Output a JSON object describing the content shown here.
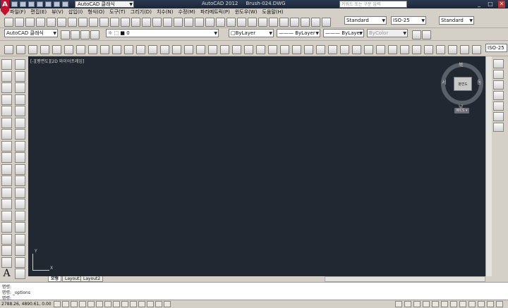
{
  "window": {
    "title": "AutoCAD 2012",
    "drawing": "Brush-024.DWG",
    "workspace": "AutoCAD 클래식",
    "search_placeholder": "키워드 또는 구문 입력",
    "min": "_",
    "max": "□",
    "close": "✕"
  },
  "menu": [
    "파일(F)",
    "편집(E)",
    "뷰(V)",
    "삽입(I)",
    "형식(O)",
    "도구(T)",
    "그리기(D)",
    "치수(N)",
    "수정(M)",
    "파라메트릭(P)",
    "윈도우(W)",
    "도움말(H)"
  ],
  "styles": {
    "text_style": "Standard",
    "dim_style": "ISO-25",
    "table_style": "Standard",
    "mleader_style": "Standard",
    "dim_style2": "ISO-25"
  },
  "workspace_toolbar": {
    "workspace": "AutoCAD 클래식",
    "layer": "0"
  },
  "properties": {
    "color": "ByLayer",
    "linetype": "ByLayer",
    "lineweight": "ByLayer",
    "plotstyle": "ByColor"
  },
  "viewport": {
    "label": "[-][평면도][2D 와이어프레임]",
    "viewcube": {
      "top": "북",
      "bottom": "남",
      "left": "서",
      "right": "동",
      "face": "평면도"
    },
    "wcs": "WCS ▾",
    "ucs_x": "X",
    "ucs_y": "Y"
  },
  "tabs": [
    "모형",
    "Layout1",
    "Layout2"
  ],
  "command": {
    "line1": "명령:",
    "line2": "명령:  _options",
    "line3": "명령:"
  },
  "status": {
    "coords": "2788.26, 4890.61, 0.00"
  }
}
